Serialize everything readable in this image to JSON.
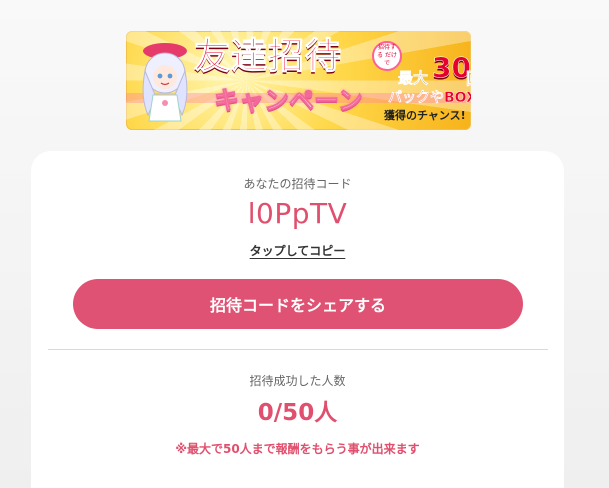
{
  "banner": {
    "title": "友達招待",
    "subtitle": "キャンペーン",
    "badge_text": "招待する だけで",
    "max_label": "最大",
    "max_number": "30",
    "max_unit": "回",
    "pack_text": "パックやBOX",
    "chance_text": "獲得のチャンス!"
  },
  "invite": {
    "code_label": "あなたの招待コード",
    "code_value": "l0PpTV",
    "copy_label": "タップしてコピー",
    "share_button": "招待コードをシェアする"
  },
  "stats": {
    "count_label": "招待成功した人数",
    "count_value": "0/50人",
    "note": "※最大で50人まで報酬をもらう事が出来ます"
  },
  "colors": {
    "accent": "#df5273",
    "accent_text": "#e0506e"
  }
}
